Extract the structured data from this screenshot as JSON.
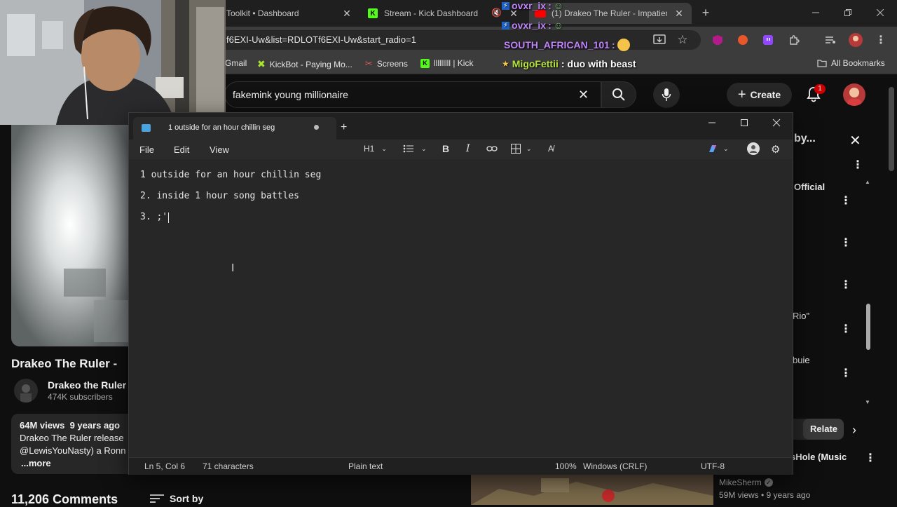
{
  "browser": {
    "tabs": [
      {
        "label": "Toolkit • Dashboard"
      },
      {
        "label": "Stream - Kick Dashboard"
      },
      {
        "label": "(1) Drakeo The Ruler - Impatien"
      }
    ],
    "url": "f6EXI-Uw&list=RDLOTf6EXI-Uw&start_radio=1",
    "bookmarks": [
      {
        "label": "Gmail"
      },
      {
        "label": "KickBot - Paying Mo..."
      },
      {
        "label": "Screens"
      },
      {
        "label": "lllllllll | Kick"
      }
    ],
    "all_bookmarks": "All Bookmarks",
    "notification_count": "1"
  },
  "chat": [
    {
      "user": "ovxr_ix",
      "sep": " :"
    },
    {
      "user": "ovxr_ix",
      "sep": " :"
    },
    {
      "user": "SOUTH_AFRICAN_101",
      "sep": " :"
    },
    {
      "user": "MigoFettii",
      "sep": " :",
      "message": "duo with beast"
    }
  ],
  "youtube": {
    "search_query": "fakemink young millionaire",
    "create_label": "Create",
    "video_title": "Drakeo The Ruler -",
    "channel_name": "Drakeo the Ruler",
    "subscribers": "474K subscribers",
    "views": "64M views",
    "age": "9 years ago",
    "description": "Drakeo The Ruler release",
    "description2": "@LewisYouNasty) a Ronn",
    "more_label": "...more",
    "comments_count": "11,206 Comments",
    "sort_by": "Sort by",
    "panel_title_fragment": "by...",
    "side_fragments": [
      "Official",
      "Rio\"",
      "buie",
      "Relate"
    ],
    "rec_title_fragment": "sHole (Music",
    "rec_channel": "MikeSherm",
    "rec_meta": "59M views • 9 years ago"
  },
  "notepad": {
    "tab_title": "1 outside for an hour chillin seg",
    "menu": [
      "File",
      "Edit",
      "View"
    ],
    "heading_label": "H1",
    "lines": [
      "1 outside for an hour chillin seg",
      "2. inside 1 hour song battles",
      "3. ;'"
    ],
    "status": {
      "position": "Ln 5, Col 6",
      "chars": "71 characters",
      "format": "Plain text",
      "zoom": "100%",
      "line_ending": "Windows (CRLF)",
      "encoding": "UTF-8"
    }
  },
  "colors": {
    "kick_green": "#53fc18",
    "chat_purple": "#c084fc",
    "youtube_red": "#ff0000",
    "notepad_bg": "#272727"
  }
}
